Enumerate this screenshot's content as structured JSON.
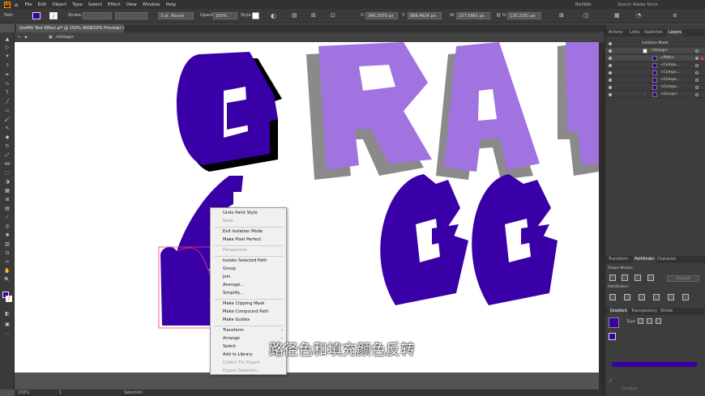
{
  "menubar": {
    "logo": "Ai",
    "items": [
      "File",
      "Edit",
      "Object",
      "Type",
      "Select",
      "Effect",
      "View",
      "Window",
      "Help"
    ],
    "workspace": "RichGfx",
    "search_placeholder": "Search Adobe Stock"
  },
  "control": {
    "selection_label": "Path",
    "stroke_label": "Stroke:",
    "stroke_profile": "3 pt. Round",
    "opacity_label": "Opacity:",
    "opacity_value": "100%",
    "style_label": "Style:",
    "x_label": "X:",
    "x_value": "346.2979 px",
    "y_label": "Y:",
    "y_value": "888.4624 px",
    "w_label": "W:",
    "w_value": "107.0963 px",
    "h_label": "H:",
    "h_value": "135.2161 px"
  },
  "document": {
    "tab_title": "Graffiti Text Effect.ai* @ 150% (RGB/GPU Preview)",
    "breadcrumb": "<Group>"
  },
  "status": {
    "zoom": "150%",
    "artboard": "1",
    "tool": "Selection"
  },
  "context_menu": {
    "items": [
      {
        "label": "Undo Paint Style",
        "disabled": false
      },
      {
        "label": "Redo",
        "disabled": true
      },
      {
        "label": "Exit Isolation Mode",
        "disabled": false
      },
      {
        "label": "Make Pixel Perfect",
        "disabled": false
      },
      {
        "label": "Perspective",
        "disabled": true
      },
      {
        "label": "Isolate Selected Path",
        "disabled": false
      },
      {
        "label": "Group",
        "disabled": false
      },
      {
        "label": "Join",
        "disabled": false
      },
      {
        "label": "Average...",
        "disabled": false
      },
      {
        "label": "Simplify...",
        "disabled": false
      },
      {
        "label": "Make Clipping Mask",
        "disabled": false
      },
      {
        "label": "Make Compound Path",
        "disabled": false
      },
      {
        "label": "Make Guides",
        "disabled": false
      },
      {
        "label": "Transform",
        "disabled": false
      },
      {
        "label": "Arrange",
        "disabled": false
      },
      {
        "label": "Select",
        "disabled": false
      },
      {
        "label": "Add to Library",
        "disabled": false
      },
      {
        "label": "Collect For Export",
        "disabled": true
      },
      {
        "label": "Export Selection...",
        "disabled": true
      }
    ]
  },
  "subtitle": "路径色和填充颜色反转",
  "panels": {
    "top_tabs": [
      "Actions",
      "Links",
      "Swatches",
      "Layers"
    ],
    "layers": [
      {
        "name": "Isolation Mode"
      },
      {
        "name": "<Group>"
      },
      {
        "name": "<Path>"
      },
      {
        "name": "<Compo..."
      },
      {
        "name": "<Compo..."
      },
      {
        "name": "<Compo..."
      },
      {
        "name": "<Compo..."
      },
      {
        "name": "<Group>"
      }
    ],
    "mid_tabs": [
      "Transform",
      "Pathfinder",
      "Character"
    ],
    "shape_modes": "Shape Modes:",
    "expand": "Expand",
    "pathfinders": "Pathfinders:",
    "bottom_tabs": [
      "Gradient",
      "Transparency",
      "Stroke"
    ],
    "type_label": "Type:",
    "angle_label": "Location:"
  },
  "colors": {
    "purple": "#3a00a8",
    "light_purple": "#a173e0",
    "shadow_gray": "#8a8a8a",
    "selection": "#ef3a6a"
  }
}
